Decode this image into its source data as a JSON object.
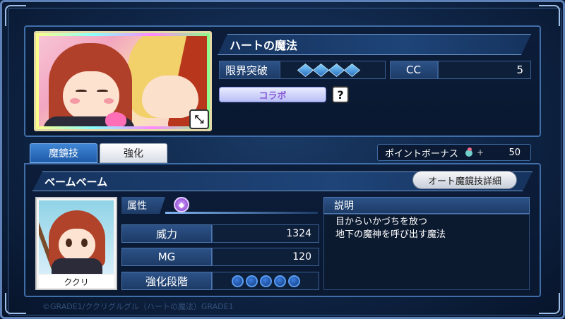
{
  "card": {
    "title": "ハートの魔法",
    "limit_break_label": "限界突破",
    "limit_break_level": 4,
    "cc_label": "CC",
    "cc_value": "5",
    "collab_label": "コラボ",
    "help_icon": "?",
    "expand_icon": "⤡"
  },
  "tabs": {
    "skill_label": "魔鏡技",
    "enhance_label": "強化"
  },
  "point_bonus": {
    "label": "ポイントボーナス",
    "plus": "+",
    "value": "50"
  },
  "skill": {
    "name": "ベームベーム",
    "auto_button_label": "オート魔鏡技詳細",
    "character_name": "ククリ",
    "attribute_label": "属性",
    "attribute_icon": "purple-magic-icon",
    "power_label": "威力",
    "power_value": "1324",
    "mg_label": "MG",
    "mg_value": "120",
    "enhance_stage_label": "強化段階",
    "enhance_stage_count": 5,
    "description_label": "説明",
    "description_line1": "目からいかづちを放つ",
    "description_line2": "地下の魔神を呼び出す魔法"
  },
  "footer": {
    "copyright": "©GRADE1/ククリグルグル（ハートの魔法）GRADE1"
  },
  "colors": {
    "panel_bg": "#0c1d3a",
    "accent_blue": "#3f86d6",
    "border_blue": "#3f6ea8",
    "collab_text": "#8a5cd9"
  }
}
